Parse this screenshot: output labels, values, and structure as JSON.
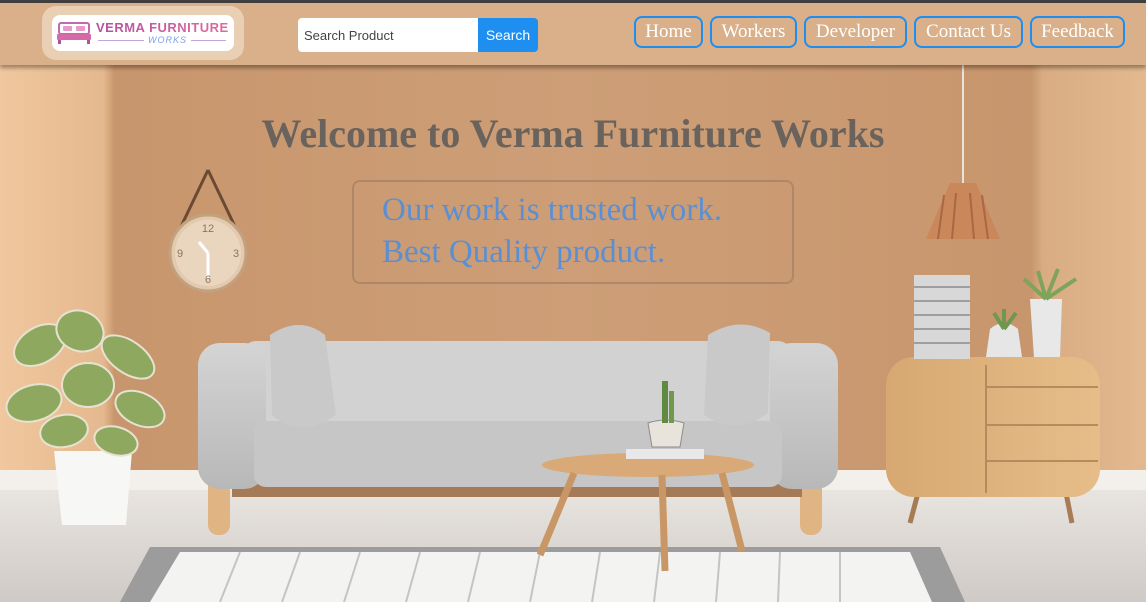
{
  "brand": {
    "name": "VERMA FURNITURE",
    "sub": "WORKS"
  },
  "search": {
    "placeholder": "Search Product",
    "button_label": "Search"
  },
  "nav": [
    {
      "label": "Home"
    },
    {
      "label": "Workers"
    },
    {
      "label": "Developer"
    },
    {
      "label": "Contact Us"
    },
    {
      "label": "Feedback"
    }
  ],
  "hero": {
    "headline": "Welcome to Verma Furniture Works",
    "tagline_1": "Our work is trusted work.",
    "tagline_2": "Best Quality product."
  },
  "clock": {
    "numerals": [
      "12",
      "3",
      "6",
      "9"
    ]
  },
  "colors": {
    "header_bg": "#d9b089",
    "accent": "#1f8ef1",
    "wall": "#c99a72",
    "tagline": "#5b8fd4",
    "headline": "#6a625c"
  }
}
